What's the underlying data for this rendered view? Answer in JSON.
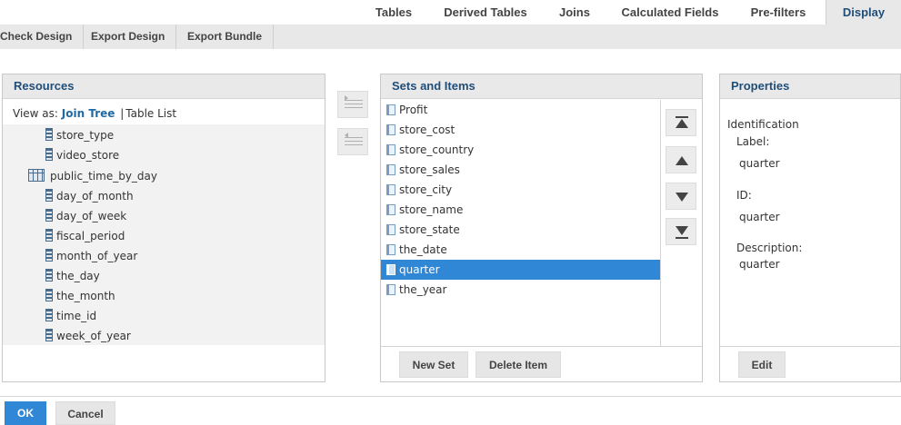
{
  "top_tabs": [
    "Tables",
    "Derived Tables",
    "Joins",
    "Calculated Fields",
    "Pre-filters",
    "Display"
  ],
  "active_tab": "Display",
  "toolbar": {
    "check_design": "Check Design",
    "export_design": "Export Design",
    "export_bundle": "Export Bundle"
  },
  "resources": {
    "title": "Resources",
    "view_as_label": "View as:",
    "join_tree": "Join Tree",
    "separator": "|",
    "table_list": "Table List",
    "tree": [
      {
        "label": "store_type",
        "kind": "column"
      },
      {
        "label": "video_store",
        "kind": "column"
      },
      {
        "label": "public_time_by_day",
        "kind": "table"
      },
      {
        "label": "day_of_month",
        "kind": "column"
      },
      {
        "label": "day_of_week",
        "kind": "column"
      },
      {
        "label": "fiscal_period",
        "kind": "column"
      },
      {
        "label": "month_of_year",
        "kind": "column"
      },
      {
        "label": "the_day",
        "kind": "column"
      },
      {
        "label": "the_month",
        "kind": "column"
      },
      {
        "label": "time_id",
        "kind": "column"
      },
      {
        "label": "week_of_year",
        "kind": "column"
      }
    ]
  },
  "sets_items": {
    "title": "Sets and Items",
    "items": [
      "Profit",
      "store_cost",
      "store_country",
      "store_sales",
      "store_city",
      "store_name",
      "store_state",
      "the_date",
      "quarter",
      "the_year"
    ],
    "selected": "quarter",
    "new_set": "New Set",
    "delete_item": "Delete Item"
  },
  "properties": {
    "title": "Properties",
    "section": "Identification",
    "label_key": "Label:",
    "label_value": "quarter",
    "id_key": "ID:",
    "id_value": "quarter",
    "description_key": "Description:",
    "description_value": "quarter",
    "edit": "Edit"
  },
  "footer": {
    "ok": "OK",
    "cancel": "Cancel"
  },
  "colors": {
    "accent": "#2f87d6",
    "header_text": "#1f4e79",
    "panel_header_bg": "#e9e9e9"
  },
  "icons": [
    "column-icon",
    "table-icon",
    "item-icon",
    "move-right-icon",
    "move-left-icon",
    "move-top-icon",
    "move-up-icon",
    "move-down-icon",
    "move-bottom-icon"
  ]
}
